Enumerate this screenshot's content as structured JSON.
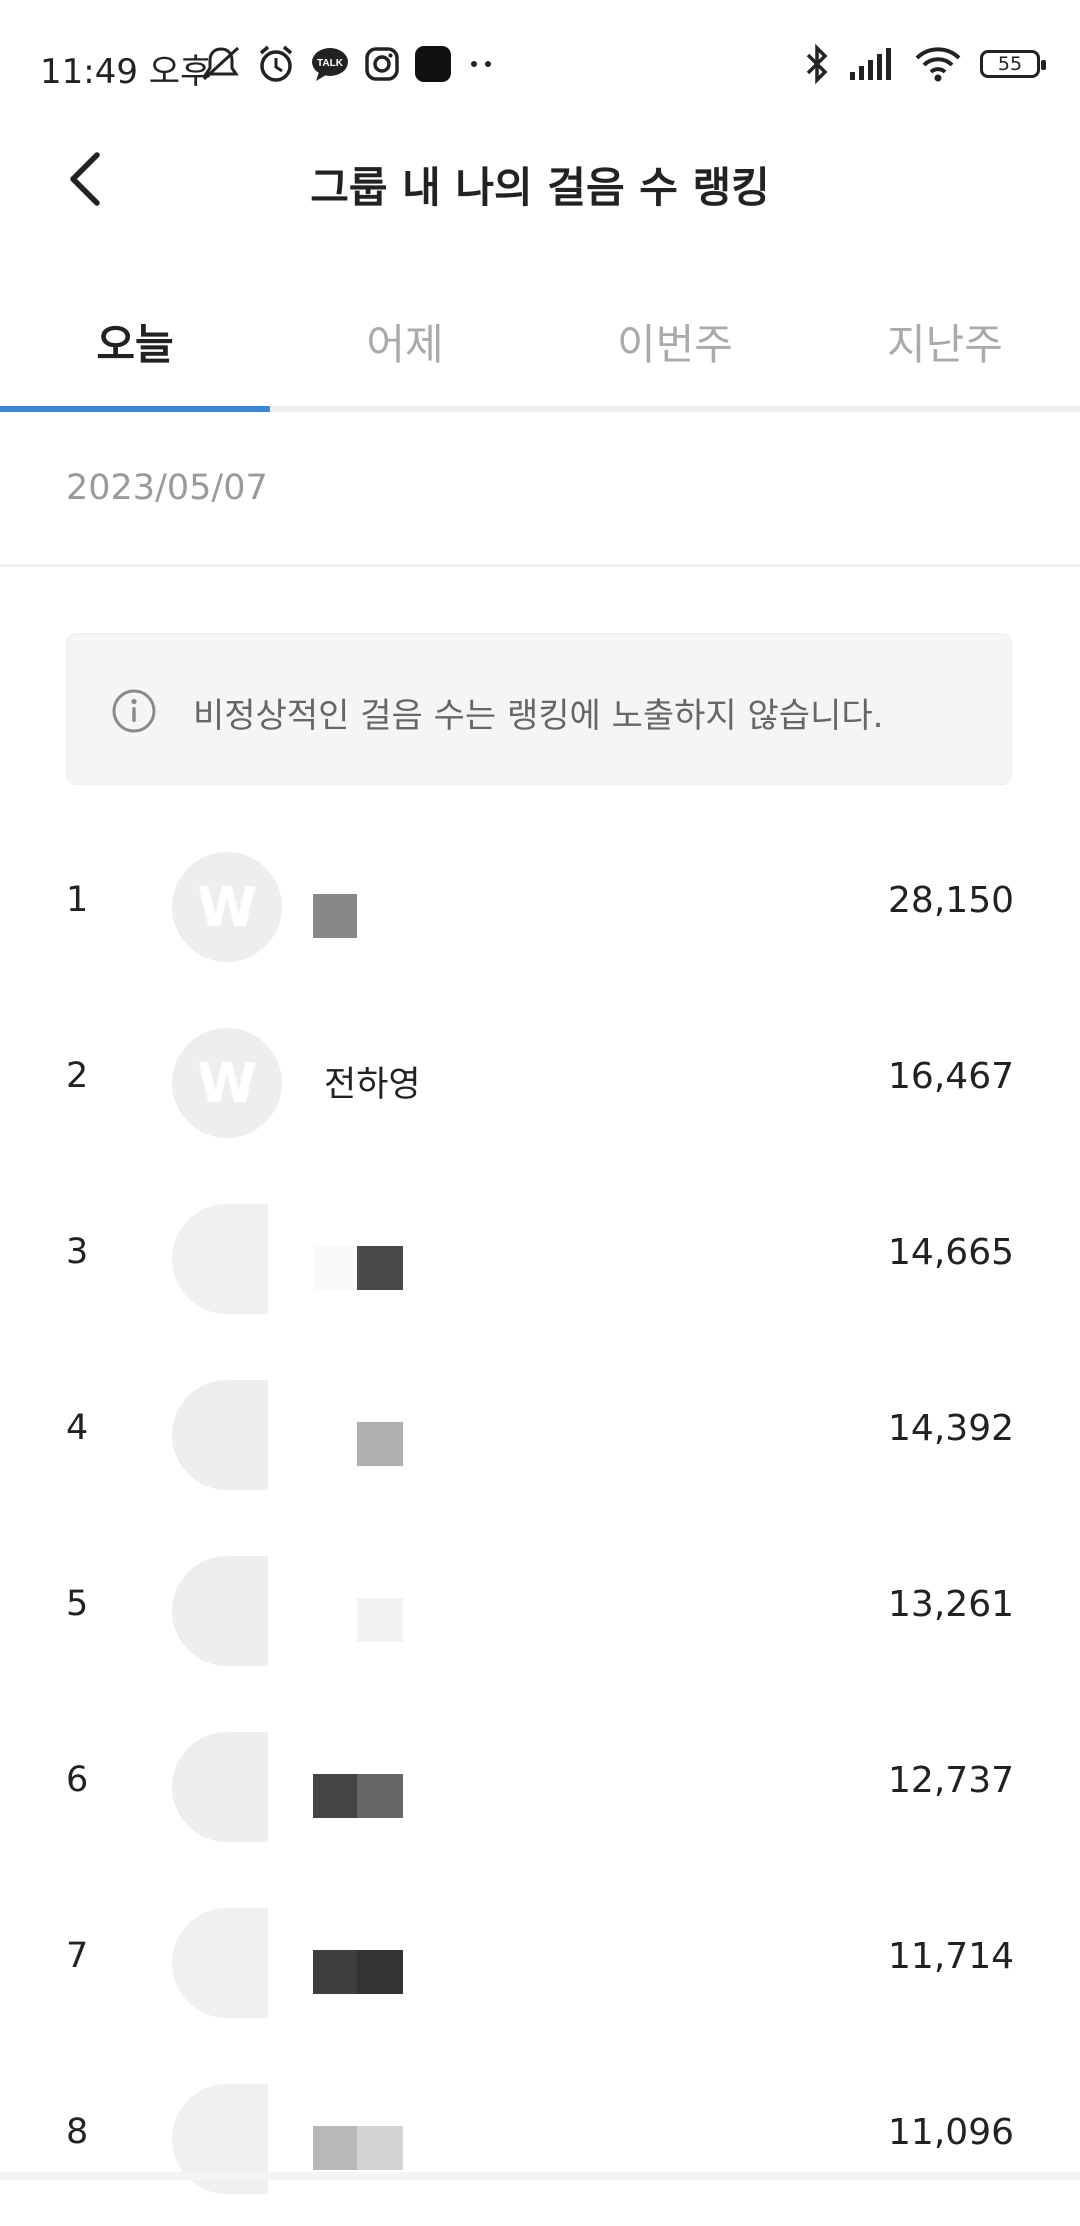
{
  "status_bar": {
    "time": "11:49 오후",
    "battery": "55",
    "left_icons": [
      "mute-icon",
      "alarm-icon",
      "kakaotalk-icon",
      "instagram-icon",
      "app-icon",
      "more-dots-icon"
    ],
    "right_icons": [
      "bluetooth-icon",
      "signal-icon",
      "wifi-icon",
      "battery-icon"
    ]
  },
  "header": {
    "title": "그룹 내 나의 걸음 수 랭킹",
    "back_icon": "chevron-left-icon"
  },
  "tabs": [
    {
      "label": "오늘",
      "active": true
    },
    {
      "label": "어제",
      "active": false
    },
    {
      "label": "이번주",
      "active": false
    },
    {
      "label": "지난주",
      "active": false
    }
  ],
  "colors": {
    "accent": "#3a86d8",
    "muted": "#9a9a9a"
  },
  "date": "2023/05/07",
  "notice": {
    "icon": "info-icon",
    "text": "비정상적인 걸음 수는 랭킹에 노출하지 않습니다."
  },
  "ranking": [
    {
      "rank": "1",
      "name": "",
      "steps": "28,150"
    },
    {
      "rank": "2",
      "name": "전하영",
      "steps": "16,467"
    },
    {
      "rank": "3",
      "name": "",
      "steps": "14,665"
    },
    {
      "rank": "4",
      "name": "",
      "steps": "14,392"
    },
    {
      "rank": "5",
      "name": "",
      "steps": "13,261"
    },
    {
      "rank": "6",
      "name": "",
      "steps": "12,737"
    },
    {
      "rank": "7",
      "name": "",
      "steps": "11,714"
    },
    {
      "rank": "8",
      "name": "",
      "steps": "11,096"
    }
  ]
}
